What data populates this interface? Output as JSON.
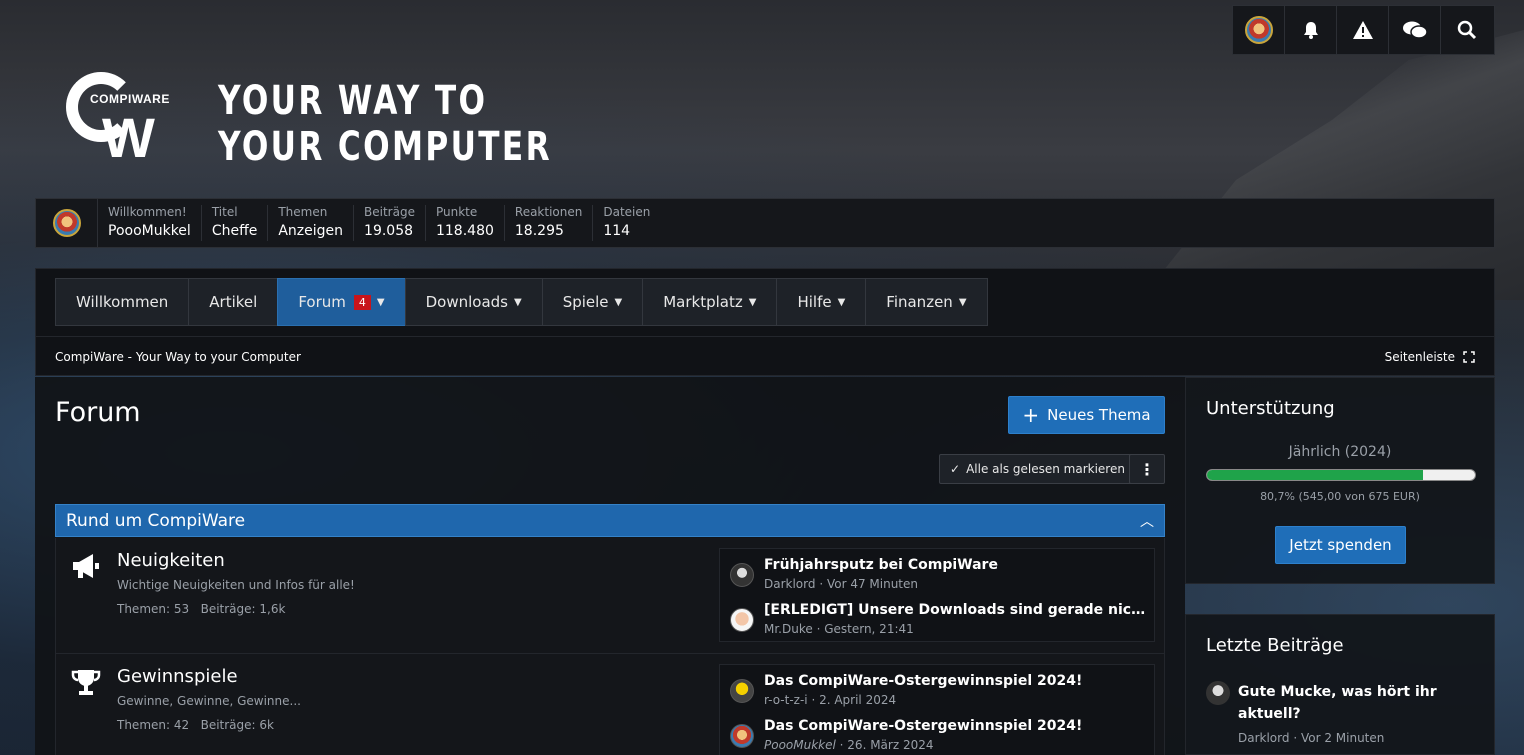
{
  "topbar": {
    "icons": [
      "user-avatar",
      "bell-icon",
      "warning-icon",
      "chat-icon",
      "search-icon"
    ]
  },
  "logo": {
    "brand": "COMPIWARE",
    "mark": "W"
  },
  "slogan": {
    "line1": "YOUR WAY TO",
    "line2": "YOUR COMPUTER"
  },
  "stats": [
    {
      "label": "Willkommen!",
      "value": "PoooMukkel"
    },
    {
      "label": "Titel",
      "value": "Cheffe"
    },
    {
      "label": "Themen",
      "value": "Anzeigen"
    },
    {
      "label": "Beiträge",
      "value": "19.058"
    },
    {
      "label": "Punkte",
      "value": "118.480"
    },
    {
      "label": "Reaktionen",
      "value": "18.295"
    },
    {
      "label": "Dateien",
      "value": "114"
    }
  ],
  "nav": {
    "items": [
      {
        "label": "Willkommen"
      },
      {
        "label": "Artikel"
      },
      {
        "label": "Forum",
        "badge": "4"
      },
      {
        "label": "Downloads"
      },
      {
        "label": "Spiele"
      },
      {
        "label": "Marktplatz"
      },
      {
        "label": "Hilfe"
      },
      {
        "label": "Finanzen"
      }
    ]
  },
  "breadcrumb": "CompiWare - Your Way to your Computer",
  "sidebar_toggle": "Seitenleiste",
  "main": {
    "title": "Forum",
    "new_thread": "Neues Thema",
    "mark_read": "Alle als gelesen markieren",
    "category": "Rund um CompiWare",
    "nodes": [
      {
        "title": "Neuigkeiten",
        "desc": "Wichtige Neuigkeiten und Infos für alle!",
        "threads_label": "Themen",
        "threads": "53",
        "posts_label": "Beiträge",
        "posts": "1,6k",
        "latest": [
          {
            "title": "Frühjahrsputz bei CompiWare",
            "user": "Darklord",
            "time": "Vor 47 Minuten"
          },
          {
            "title": "[ERLEDIGT] Unsere Downloads sind gerade nicht erreichbar",
            "user": "Mr.Duke",
            "time": "Gestern, 21:41"
          }
        ]
      },
      {
        "title": "Gewinnspiele",
        "desc": "Gewinne, Gewinne, Gewinne...",
        "threads_label": "Themen",
        "threads": "42",
        "posts_label": "Beiträge",
        "posts": "6k",
        "latest": [
          {
            "title": "Das CompiWare-Ostergewinnspiel 2024!",
            "user": "r-o-t-z-i",
            "time": "2. April 2024"
          },
          {
            "title": "Das CompiWare-Ostergewinnspiel 2024!",
            "user": "PoooMukkel",
            "time": "26. März 2024"
          }
        ]
      }
    ]
  },
  "support": {
    "title": "Unterstützung",
    "period": "Jährlich (2024)",
    "progress": 0.807,
    "progress_text": "80,7% (545,00 von 675 EUR)",
    "button": "Jetzt spenden"
  },
  "recent": {
    "title": "Letzte Beiträge",
    "post": {
      "title": "Gute Mucke, was hört ihr aktuell?",
      "user": "Darklord",
      "time": "Vor 2 Minuten"
    }
  },
  "colors": {
    "accent": "#1f6eb8",
    "progress": "#1fa34a",
    "badge": "#c8141b"
  }
}
